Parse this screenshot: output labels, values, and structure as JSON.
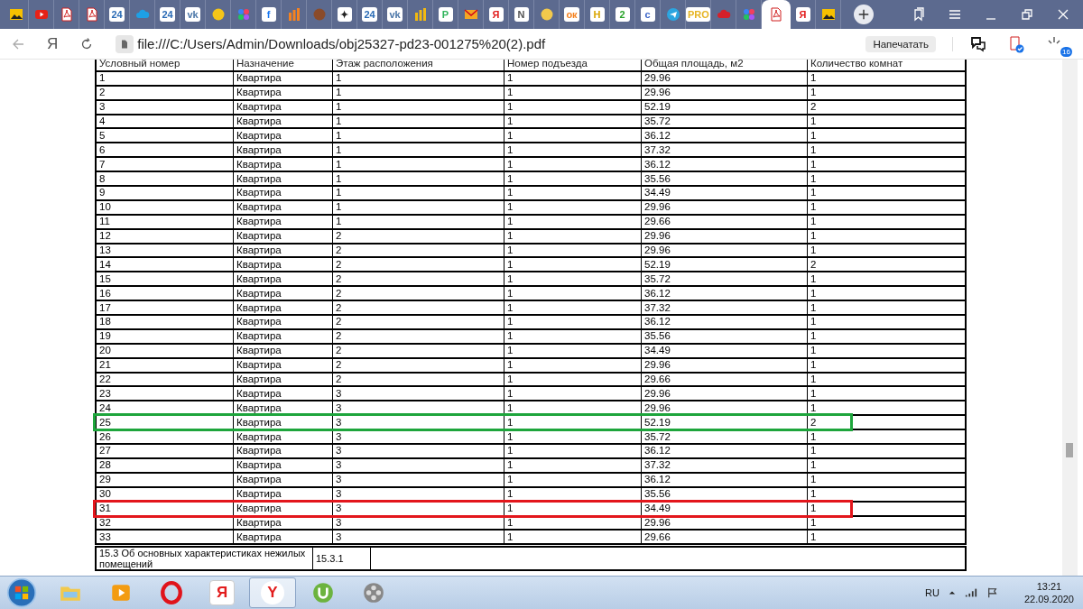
{
  "tabs": [
    {
      "kind": "image",
      "selected": false
    },
    {
      "kind": "play",
      "color": "#e62117",
      "selected": false
    },
    {
      "kind": "pdf",
      "selected": false
    },
    {
      "kind": "pdf",
      "selected": false
    },
    {
      "kind": "text",
      "glyph": "24",
      "color": "#2a6bb5",
      "selected": false
    },
    {
      "kind": "cloud",
      "color": "#1ea0e6",
      "selected": false
    },
    {
      "kind": "text",
      "glyph": "24",
      "color": "#2a6bb5",
      "selected": false
    },
    {
      "kind": "text",
      "glyph": "vk",
      "color": "#4a76a8",
      "selected": false
    },
    {
      "kind": "circle",
      "color": "#f5c518",
      "selected": false
    },
    {
      "kind": "dots",
      "selected": false
    },
    {
      "kind": "text",
      "glyph": "f",
      "color": "#1877f2",
      "selected": false
    },
    {
      "kind": "bars",
      "color": "#f58220",
      "selected": false
    },
    {
      "kind": "circle",
      "color": "#8a4b2a",
      "selected": false
    },
    {
      "kind": "text",
      "glyph": "✦",
      "color": "#222222",
      "selected": false
    },
    {
      "kind": "text",
      "glyph": "24",
      "color": "#2a6bb5",
      "selected": false
    },
    {
      "kind": "text",
      "glyph": "vk",
      "color": "#4a76a8",
      "selected": false
    },
    {
      "kind": "bars",
      "color": "#f2b90f",
      "selected": false
    },
    {
      "kind": "text",
      "glyph": "P",
      "color": "#2fb45a",
      "selected": false
    },
    {
      "kind": "envelope",
      "color": "#f5a623",
      "selected": false
    },
    {
      "kind": "text",
      "glyph": "Я",
      "color": "#e21c1c",
      "selected": false
    },
    {
      "kind": "text",
      "glyph": "N",
      "color": "#555555",
      "selected": false
    },
    {
      "kind": "circle",
      "color": "#f2c94c",
      "selected": false
    },
    {
      "kind": "text",
      "glyph": "ок",
      "color": "#f58220",
      "selected": false
    },
    {
      "kind": "text",
      "glyph": "H",
      "color": "#d9a400",
      "selected": false
    },
    {
      "kind": "text",
      "glyph": "2",
      "color": "#29a329",
      "selected": false
    },
    {
      "kind": "text",
      "glyph": "c",
      "color": "#3a64c8",
      "selected": false
    },
    {
      "kind": "plane",
      "color": "#2ca5e0",
      "selected": false
    },
    {
      "kind": "text",
      "glyph": "PRO",
      "color": "#e6b422",
      "selected": false
    },
    {
      "kind": "cloud",
      "color": "#d6202a",
      "selected": false
    },
    {
      "kind": "dots",
      "selected": false
    },
    {
      "kind": "pdf",
      "selected": true
    },
    {
      "kind": "text",
      "glyph": "Я",
      "color": "#e21c1c",
      "selected": false
    },
    {
      "kind": "image",
      "selected": false
    }
  ],
  "address_bar": {
    "yandex_glyph": "Я",
    "url": "file:///C:/Users/Admin/Downloads/obj25327-pd23-001275%20(2).pdf",
    "print_button": "Напечатать",
    "extension_badge": "16"
  },
  "table": {
    "columns": [
      "Условный номер",
      "Назначение",
      "Этаж расположения",
      "Номер подъезда",
      "Общая площадь, м2",
      "Количество комнат"
    ],
    "rows": [
      {
        "cells": [
          "1",
          "Квартира",
          "1",
          "1",
          "29.96",
          "1"
        ]
      },
      {
        "cells": [
          "2",
          "Квартира",
          "1",
          "1",
          "29.96",
          "1"
        ]
      },
      {
        "cells": [
          "3",
          "Квартира",
          "1",
          "1",
          "52.19",
          "2"
        ]
      },
      {
        "cells": [
          "4",
          "Квартира",
          "1",
          "1",
          "35.72",
          "1"
        ]
      },
      {
        "cells": [
          "5",
          "Квартира",
          "1",
          "1",
          "36.12",
          "1"
        ]
      },
      {
        "cells": [
          "6",
          "Квартира",
          "1",
          "1",
          "37.32",
          "1"
        ]
      },
      {
        "cells": [
          "7",
          "Квартира",
          "1",
          "1",
          "36.12",
          "1"
        ]
      },
      {
        "cells": [
          "8",
          "Квартира",
          "1",
          "1",
          "35.56",
          "1"
        ]
      },
      {
        "cells": [
          "9",
          "Квартира",
          "1",
          "1",
          "34.49",
          "1"
        ]
      },
      {
        "cells": [
          "10",
          "Квартира",
          "1",
          "1",
          "29.96",
          "1"
        ]
      },
      {
        "cells": [
          "11",
          "Квартира",
          "1",
          "1",
          "29.66",
          "1"
        ]
      },
      {
        "cells": [
          "12",
          "Квартира",
          "2",
          "1",
          "29.96",
          "1"
        ]
      },
      {
        "cells": [
          "13",
          "Квартира",
          "2",
          "1",
          "29.96",
          "1"
        ]
      },
      {
        "cells": [
          "14",
          "Квартира",
          "2",
          "1",
          "52.19",
          "2"
        ]
      },
      {
        "cells": [
          "15",
          "Квартира",
          "2",
          "1",
          "35.72",
          "1"
        ]
      },
      {
        "cells": [
          "16",
          "Квартира",
          "2",
          "1",
          "36.12",
          "1"
        ]
      },
      {
        "cells": [
          "17",
          "Квартира",
          "2",
          "1",
          "37.32",
          "1"
        ]
      },
      {
        "cells": [
          "18",
          "Квартира",
          "2",
          "1",
          "36.12",
          "1"
        ]
      },
      {
        "cells": [
          "19",
          "Квартира",
          "2",
          "1",
          "35.56",
          "1"
        ]
      },
      {
        "cells": [
          "20",
          "Квартира",
          "2",
          "1",
          "34.49",
          "1"
        ]
      },
      {
        "cells": [
          "21",
          "Квартира",
          "2",
          "1",
          "29.96",
          "1"
        ]
      },
      {
        "cells": [
          "22",
          "Квартира",
          "2",
          "1",
          "29.66",
          "1"
        ]
      },
      {
        "cells": [
          "23",
          "Квартира",
          "3",
          "1",
          "29.96",
          "1"
        ]
      },
      {
        "cells": [
          "24",
          "Квартира",
          "3",
          "1",
          "29.96",
          "1"
        ]
      },
      {
        "cells": [
          "25",
          "Квартира",
          "3",
          "1",
          "52.19",
          "2"
        ],
        "color": "#1ea53c"
      },
      {
        "cells": [
          "26",
          "Квартира",
          "3",
          "1",
          "35.72",
          "1"
        ]
      },
      {
        "cells": [
          "27",
          "Квартира",
          "3",
          "1",
          "36.12",
          "1"
        ]
      },
      {
        "cells": [
          "28",
          "Квартира",
          "3",
          "1",
          "37.32",
          "1"
        ]
      },
      {
        "cells": [
          "29",
          "Квартира",
          "3",
          "1",
          "36.12",
          "1"
        ]
      },
      {
        "cells": [
          "30",
          "Квартира",
          "3",
          "1",
          "35.56",
          "1"
        ]
      },
      {
        "cells": [
          "31",
          "Квартира",
          "3",
          "1",
          "34.49",
          "1"
        ],
        "color": "#e3161c"
      },
      {
        "cells": [
          "32",
          "Квартира",
          "3",
          "1",
          "29.96",
          "1"
        ]
      },
      {
        "cells": [
          "33",
          "Квартира",
          "3",
          "1",
          "29.66",
          "1"
        ]
      }
    ]
  },
  "section": {
    "title": "15.3 Об основных характеристиках нежилых помещений",
    "number": "15.3.1"
  },
  "taskbar": {
    "apps": [
      {
        "kind": "folder",
        "selected": false
      },
      {
        "kind": "player",
        "selected": false
      },
      {
        "kind": "opera",
        "selected": false
      },
      {
        "kind": "yandex",
        "glyph": "Я",
        "selected": false
      },
      {
        "kind": "ybrowser",
        "glyph": "Y",
        "selected": true
      },
      {
        "kind": "torrent",
        "selected": false
      },
      {
        "kind": "reel",
        "selected": false
      }
    ],
    "language": "RU",
    "time": "13:21",
    "date": "22.09.2020"
  }
}
